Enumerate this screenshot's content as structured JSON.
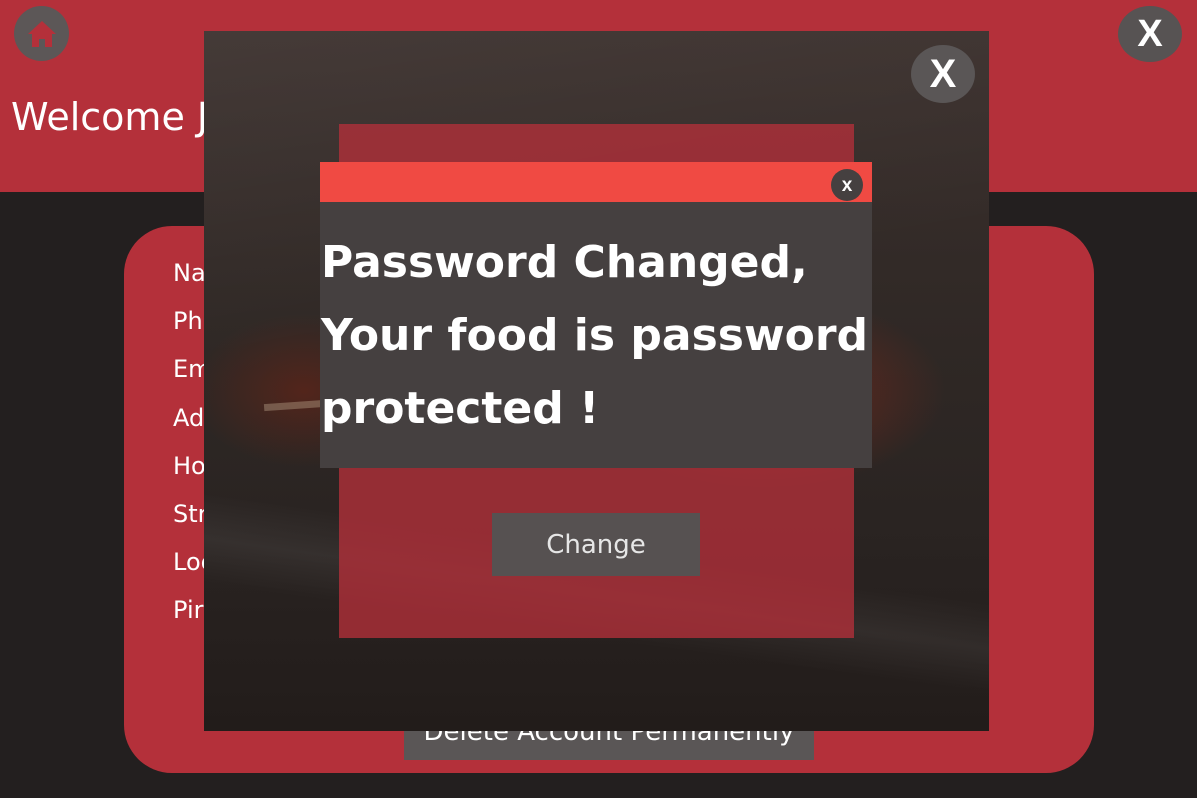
{
  "header": {
    "welcome_text": "Welcome J",
    "home_icon": "home-icon",
    "close_label": "X"
  },
  "profile": {
    "fields": [
      "Na",
      "Ph",
      "Em",
      "Ad",
      "Ho",
      "Str",
      "Loc",
      "Pir"
    ],
    "delete_label": "Delete Account Permanently"
  },
  "photo_modal": {
    "close_label": "X",
    "change_label": "Change"
  },
  "alert": {
    "close_label": "x",
    "message": "Password Changed, Your food is password protected !"
  },
  "colors": {
    "brand_red": "#b4303a",
    "alert_red": "#f04a43",
    "dark_bg": "#231f1f",
    "button_gray": "#565151"
  }
}
